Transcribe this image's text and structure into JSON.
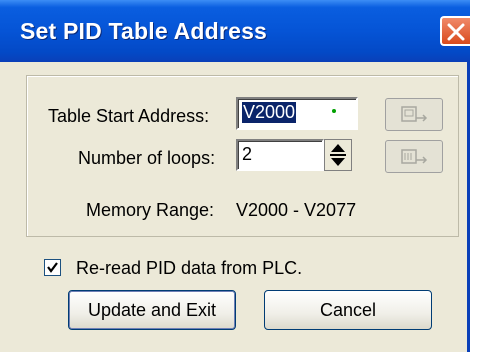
{
  "dialog": {
    "title": "Set PID Table Address",
    "close_icon": "close-x-icon"
  },
  "form": {
    "start_address_label": "Table Start Address:",
    "start_address_value": "V2000",
    "loops_label": "Number of loops:",
    "loops_value": "2",
    "memory_range_label": "Memory Range:",
    "memory_range_value": "V2000 - V2077",
    "icon_buttons": [
      "read-table-icon",
      "write-table-icon"
    ]
  },
  "options": {
    "reread_label": "Re-read PID data from PLC.",
    "reread_checked": true
  },
  "buttons": {
    "update_label": "Update and Exit",
    "cancel_label": "Cancel"
  },
  "colors": {
    "titlebar": "#0554d6",
    "close": "#d94a1c",
    "dialog_bg": "#ece9d8",
    "selection": "#0a246a"
  }
}
